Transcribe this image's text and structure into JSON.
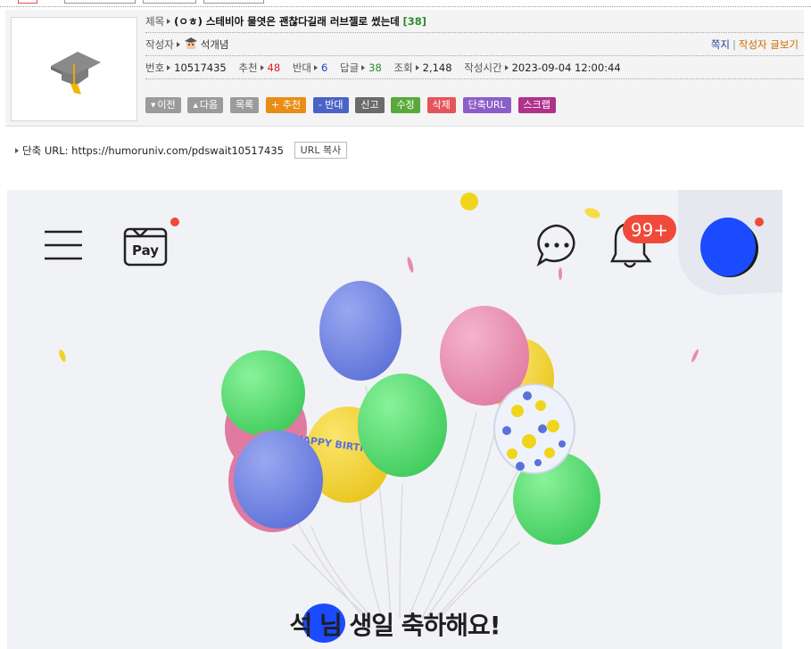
{
  "post": {
    "title_label": "제목",
    "title": "(ㅇㅎ) 스테비아 물엿은 괜찮다길래 러브젤로 썼는데",
    "comment_count": "[38]",
    "author_label": "작성자",
    "author_name": "석개념",
    "links": {
      "message": "쪽지",
      "separator": "|",
      "author_posts": "작성자 글보기"
    },
    "stats": {
      "number_label": "번호",
      "number": "10517435",
      "recommend_label": "추천",
      "recommend": "48",
      "oppose_label": "반대",
      "oppose": "6",
      "replies_label": "답글",
      "replies": "38",
      "views_label": "조회",
      "views": "2,148",
      "time_label": "작성시간",
      "time": "2023-09-04 12:00:44"
    },
    "buttons": {
      "prev": "이전",
      "next": "다음",
      "list": "목록",
      "recommend": "+ 추천",
      "oppose": "- 반대",
      "report": "신고",
      "edit": "수정",
      "delete": "삭제",
      "short_url": "단축URL",
      "scrap": "스크랩"
    }
  },
  "short_url": {
    "label": "단축 URL:",
    "url": "https://humoruniv.com/pdswait10517435",
    "copy_button": "URL 복사"
  },
  "embedded_image": {
    "pay_label": "Pay",
    "notification_badge": "99+",
    "balloon_text": "HAPPY BIRTHDAY",
    "greeting": "석    님 생일 축하해요!",
    "icons": [
      "menu-icon",
      "pay-icon",
      "chat-icon",
      "bell-icon",
      "avatar"
    ],
    "colors": {
      "badge": "#f04a3a",
      "redaction": "#1a4bff",
      "background": "#f1f2f6"
    }
  },
  "colors": {
    "recommend": "#e0202a",
    "oppose": "#2244cc",
    "replies": "#2e8b2e",
    "message_link": "#2a3a9a",
    "posts_link": "#d06a00"
  }
}
